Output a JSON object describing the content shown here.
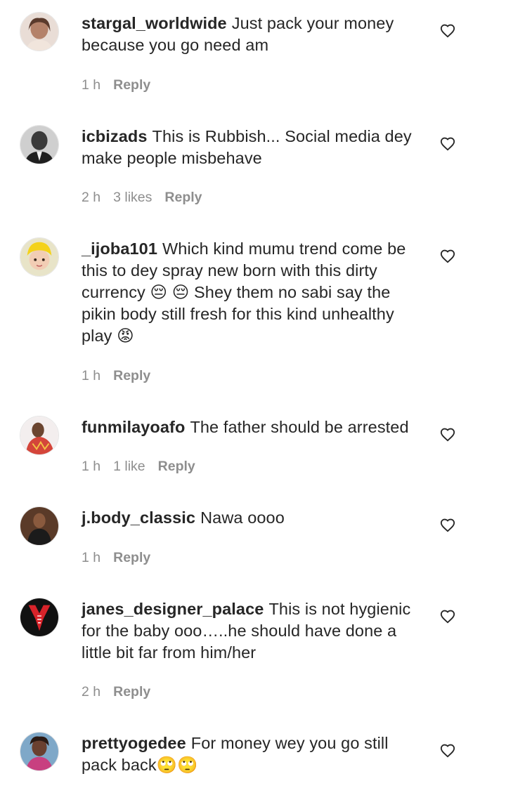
{
  "comments": [
    {
      "username": "stargal_worldwide",
      "text": "Just pack your money because you go need am",
      "time": "1 h",
      "likes": "",
      "reply": "Reply"
    },
    {
      "username": "icbizads",
      "text": "This is Rubbish... Social media dey make people misbehave",
      "time": "2 h",
      "likes": "3 likes",
      "reply": "Reply"
    },
    {
      "username": "_ijoba101",
      "text": "Which kind mumu trend come be this to dey spray new born with this dirty currency 😔 😔 Shey them no sabi say the pikin body still fresh for this kind unhealthy play 😡",
      "time": "1 h",
      "likes": "",
      "reply": "Reply"
    },
    {
      "username": "funmilayoafo",
      "text": "The father should be arrested",
      "time": "1 h",
      "likes": "1 like",
      "reply": "Reply"
    },
    {
      "username": "j.body_classic",
      "text": "Nawa oooo",
      "time": "1 h",
      "likes": "",
      "reply": "Reply"
    },
    {
      "username": "janes_designer_palace",
      "text": "This is not hygienic for the baby ooo…..he should have done a little bit far from him/her",
      "time": "2 h",
      "likes": "",
      "reply": "Reply"
    },
    {
      "username": "prettyogedee",
      "text": "For money wey you go still pack back🙄🙄",
      "time": "",
      "likes": "",
      "reply": ""
    }
  ],
  "colors": {
    "text": "#262626",
    "meta": "#8e8e8e",
    "background": "#ffffff"
  }
}
